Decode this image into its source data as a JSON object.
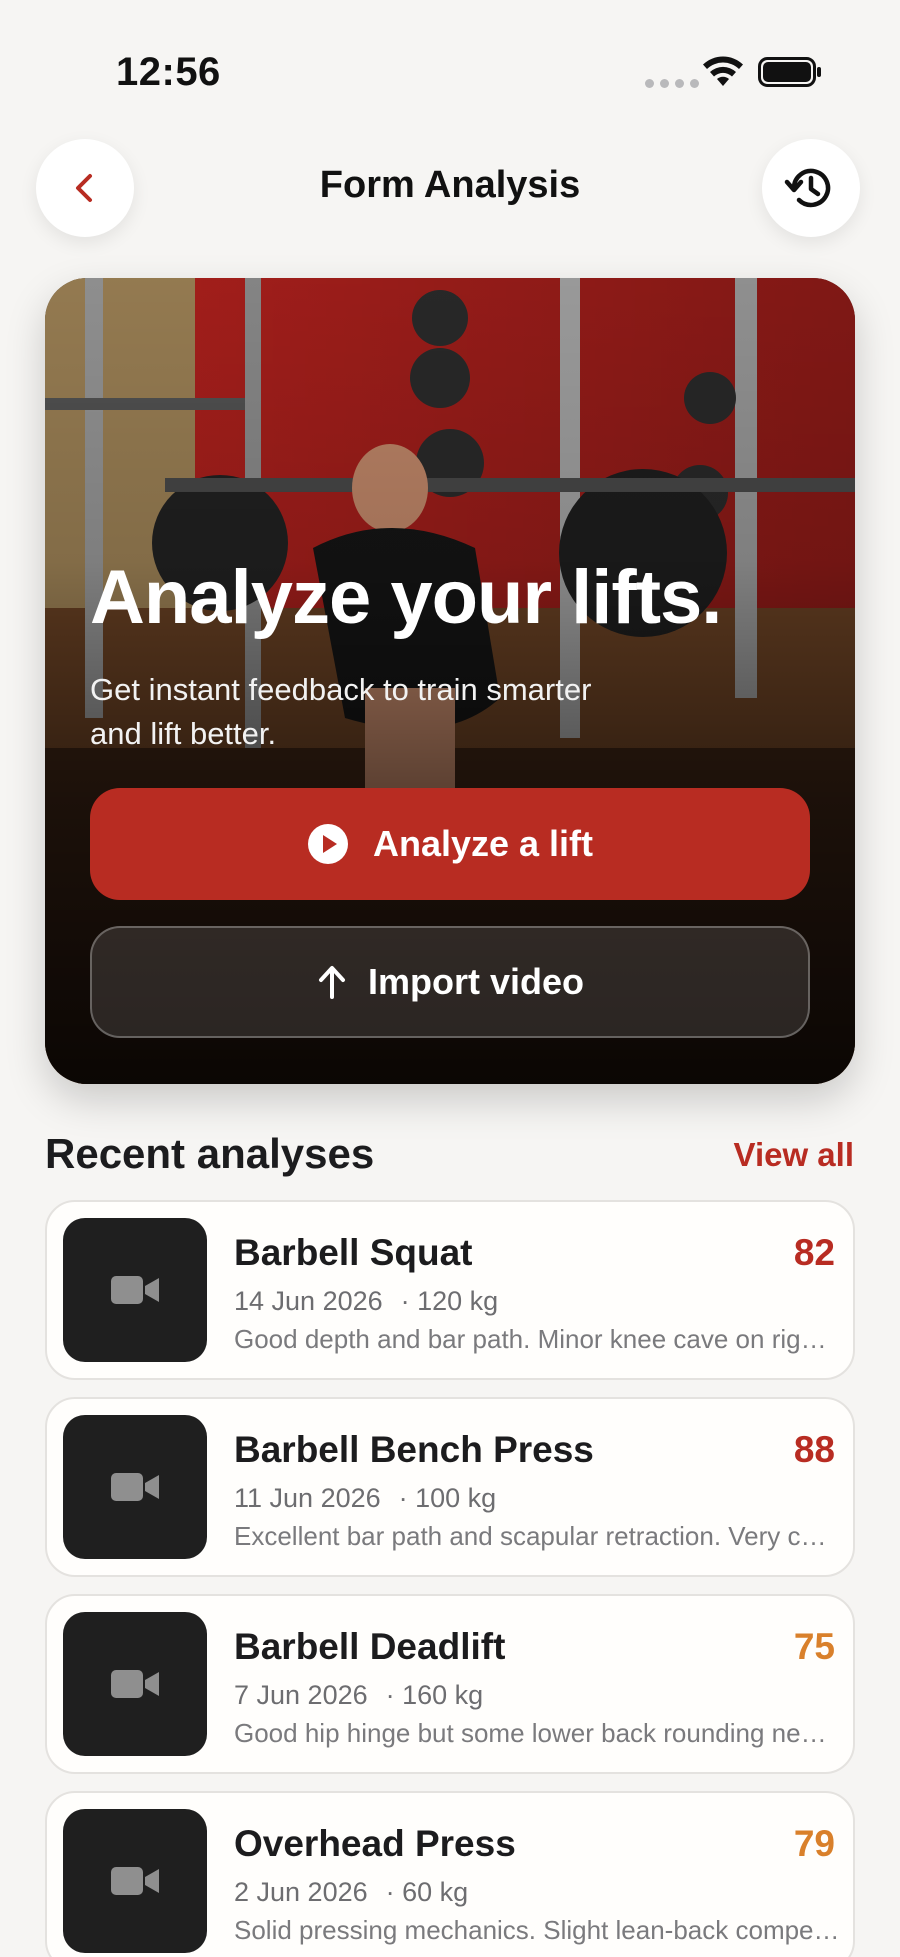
{
  "status_bar": {
    "time": "12:56"
  },
  "nav": {
    "title": "Form Analysis"
  },
  "hero": {
    "title": "Analyze your lifts.",
    "subtitle": "Get instant feedback to train smarter and lift better.",
    "primary_label": "Analyze a lift",
    "secondary_label": "Import video"
  },
  "recent": {
    "title": "Recent analyses",
    "view_all": "View all",
    "items": [
      {
        "name": "Barbell Squat",
        "date": "14 Jun 2026",
        "weight": "· 120 kg",
        "score": "82",
        "score_color": "#b82c22",
        "summary": "Good depth and bar path. Minor knee cave on right side during ascent."
      },
      {
        "name": "Barbell Bench Press",
        "date": "11 Jun 2026",
        "weight": "· 100 kg",
        "score": "88",
        "score_color": "#b82c22",
        "summary": "Excellent bar path and scapular retraction. Very consistent reps."
      },
      {
        "name": "Barbell Deadlift",
        "date": "7 Jun 2026",
        "weight": "· 160 kg",
        "score": "75",
        "score_color": "#d9802b",
        "summary": "Good hip hinge but some lower back rounding near lockout."
      },
      {
        "name": "Overhead Press",
        "date": "2 Jun 2026",
        "weight": "· 60 kg",
        "score": "79",
        "score_color": "#d9802b",
        "summary": "Solid pressing mechanics. Slight lean-back compensating at top."
      }
    ]
  },
  "colors": {
    "accent": "#b82c22",
    "warning": "#d9802b",
    "background": "#f6f5f3"
  },
  "icons": [
    "back-chevron-icon",
    "history-icon",
    "play-circle-icon",
    "upload-arrow-icon",
    "video-camera-icon",
    "wifi-icon",
    "battery-icon"
  ]
}
